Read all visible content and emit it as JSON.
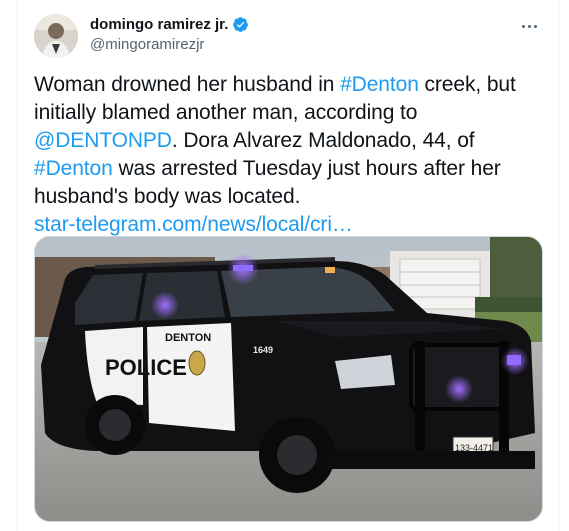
{
  "user": {
    "display_name": "domingo ramirez jr.",
    "handle": "@mingoramirezjr",
    "avatar_icon": "avatar-photo",
    "verified_icon": "verified-badge-icon",
    "verified_color": "#1d9bf0"
  },
  "more_icon": "more-options-icon",
  "tweet": {
    "seg1": "Woman drowned her husband in ",
    "tag1": "#Denton",
    "seg2": " creek, but initially blamed another man, according to ",
    "mention": "@DENTONPD",
    "seg3": ". Dora Alvarez Maldonado, 44, of ",
    "tag2": "#Denton",
    "seg4": " was arrested Tuesday just hours after her husband's body was located.",
    "url": "star-telegram.com/news/local/cri…"
  },
  "media": {
    "door_text": "DENTON",
    "door_text_main": "POLICE",
    "unit_number": "1649",
    "plate": "133-4471"
  },
  "colors": {
    "link": "#1d9bf0",
    "text": "#0f1419",
    "secondary": "#536471"
  }
}
